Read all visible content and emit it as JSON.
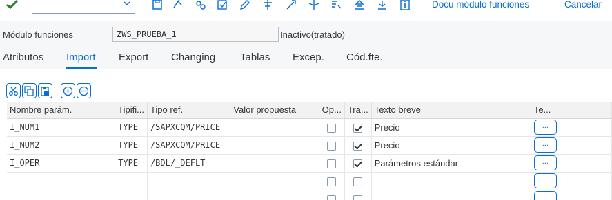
{
  "toolbar": {
    "command_value": "",
    "docu_label": "Docu módulo funciones",
    "cancel_label": "Cancelar",
    "icons": [
      "save-icon",
      "other-object-icon",
      "activate-icon",
      "check-icon",
      "edit-icon",
      "where-used-icon",
      "display-object-list-icon",
      "navigation-icon",
      "pretty-printer-icon",
      "upload-icon",
      "download-icon",
      "info-icon"
    ]
  },
  "header": {
    "module_label": "Módulo funciones",
    "module_name": "ZWS_PRUEBA_1",
    "status": "Inactivo(tratado)"
  },
  "tabs": [
    {
      "label": "Atributos",
      "active": false
    },
    {
      "label": "Import",
      "active": true
    },
    {
      "label": "Export",
      "active": false
    },
    {
      "label": "Changing",
      "active": false
    },
    {
      "label": "Tablas",
      "active": false
    },
    {
      "label": "Excep.",
      "active": false
    },
    {
      "label": "Cód.fte.",
      "active": false
    }
  ],
  "grid_toolbar": [
    "cut-row-icon",
    "copy-row-icon",
    "paste-row-icon",
    "insert-row-icon",
    "delete-row-icon"
  ],
  "table": {
    "columns": [
      "Nombre parám.",
      "Tipifi...",
      "Tipo ref.",
      "Valor propuesta",
      "Op...",
      "Tra...",
      "Texto breve",
      "Te..."
    ],
    "rows": [
      {
        "name": "I_NUM1",
        "typing": "TYPE",
        "ref_type": "/SAPXCQM/PRICE",
        "default": "",
        "optional": false,
        "pass_value": true,
        "short_text": "Precio",
        "long_text": "..."
      },
      {
        "name": "I_NUM2",
        "typing": "TYPE",
        "ref_type": "/SAPXCQM/PRICE",
        "default": "",
        "optional": false,
        "pass_value": true,
        "short_text": "Precio",
        "long_text": "..."
      },
      {
        "name": "I_OPER",
        "typing": "TYPE",
        "ref_type": "/BDL/_DEFLT",
        "default": "",
        "optional": false,
        "pass_value": true,
        "short_text": "Parámetros estándar",
        "long_text": "..."
      },
      {
        "name": "",
        "typing": "",
        "ref_type": "",
        "default": "",
        "optional": false,
        "pass_value": false,
        "short_text": "",
        "long_text": ""
      },
      {
        "name": "",
        "typing": "",
        "ref_type": "",
        "default": "",
        "optional": false,
        "pass_value": false,
        "short_text": "",
        "long_text": ""
      }
    ]
  }
}
